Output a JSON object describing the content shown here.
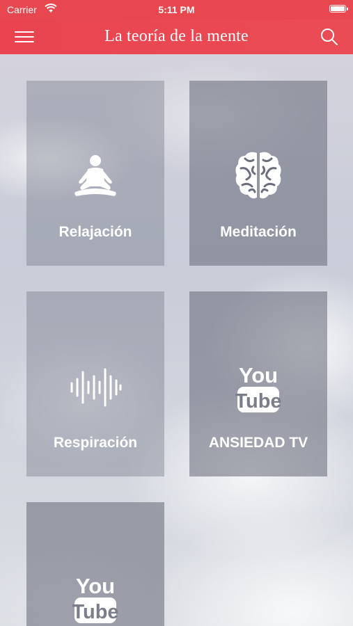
{
  "status": {
    "carrier": "Carrier",
    "time": "5:11 PM"
  },
  "nav": {
    "title": "La teoría de la mente",
    "menu_icon": "hamburger-menu-icon",
    "search_icon": "search-icon"
  },
  "tiles": [
    {
      "label": "Relajación",
      "icon": "meditation-person-icon"
    },
    {
      "label": "Meditación",
      "icon": "brain-icon"
    },
    {
      "label": "Respiración",
      "icon": "sound-wave-icon"
    },
    {
      "label": "ANSIEDAD TV",
      "icon": "youtube-icon"
    },
    {
      "label": "",
      "icon": "youtube-icon"
    }
  ],
  "youtube_text": {
    "you": "You",
    "tube": "Tube"
  },
  "colors": {
    "accent": "#e8474f",
    "tile_overlay": "#787c8a"
  }
}
